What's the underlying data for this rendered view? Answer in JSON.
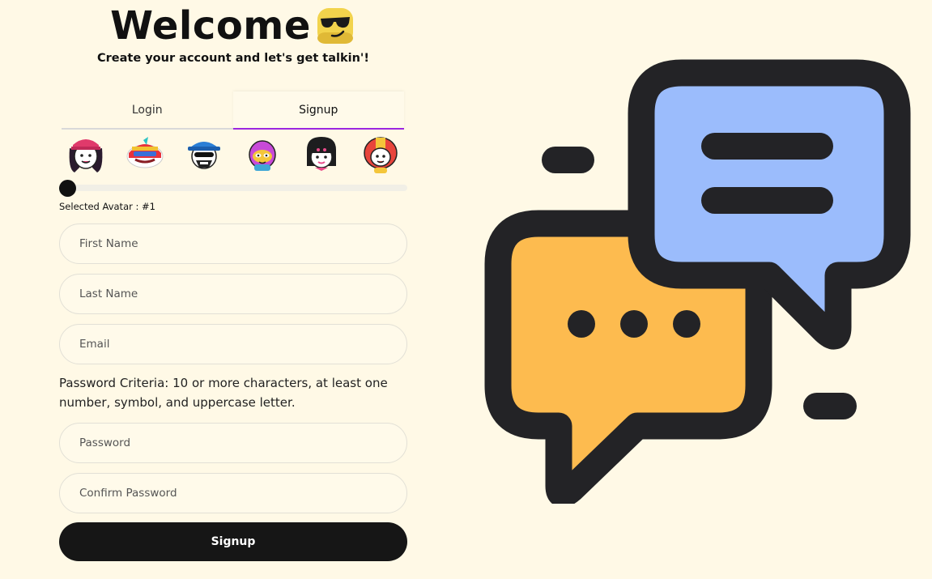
{
  "header": {
    "title": "Welcome",
    "subtitle": "Create your account and let's get talkin'!",
    "emoji_icon": "sunglasses-emoji-icon"
  },
  "tabs": [
    {
      "label": "Login",
      "active": false
    },
    {
      "label": "Signup",
      "active": true
    }
  ],
  "avatars": {
    "items": [
      "avatar-1",
      "avatar-2",
      "avatar-3",
      "avatar-4",
      "avatar-5",
      "avatar-6"
    ],
    "selected_label": "Selected Avatar : #1",
    "slider_value": 1,
    "slider_max": 6
  },
  "form": {
    "first_name_placeholder": "First Name",
    "last_name_placeholder": "Last Name",
    "email_placeholder": "Email",
    "password_criteria": "Password Criteria: 10 or more characters, at least one number, symbol, and uppercase letter.",
    "password_placeholder": "Password",
    "confirm_password_placeholder": "Confirm Password",
    "submit_label": "Signup"
  },
  "illustration": {
    "icon": "chat-bubbles-icon"
  },
  "colors": {
    "background": "#fff9e6",
    "accent": "#9c27e0",
    "button": "#161616",
    "bubble_blue": "#9bbcfc",
    "bubble_orange": "#fdbb4f",
    "outline": "#232326"
  }
}
